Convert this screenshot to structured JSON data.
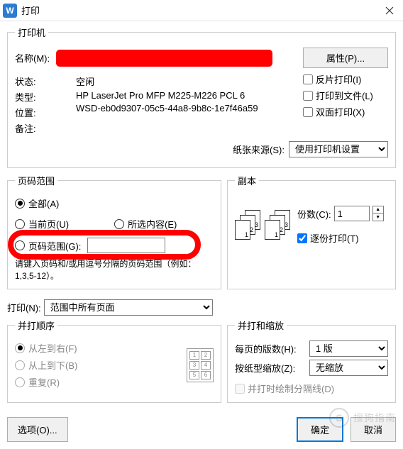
{
  "title": "打印",
  "printer": {
    "legend": "打印机",
    "name_label": "名称(M):",
    "properties_btn": "属性(P)...",
    "status_label": "状态:",
    "status_value": "空闲",
    "type_label": "类型:",
    "type_value": "HP LaserJet Pro MFP M225-M226 PCL 6",
    "location_label": "位置:",
    "location_value": "WSD-eb0d9307-05c5-44a8-9b8c-1e7f46a59",
    "notes_label": "备注:",
    "mirror": "反片打印(I)",
    "to_file": "打印到文件(L)",
    "duplex": "双面打印(X)",
    "source_label": "纸张来源(S):",
    "source_value": "使用打印机设置"
  },
  "range": {
    "legend": "页码范围",
    "all": "全部(A)",
    "current": "当前页(U)",
    "selection": "所选内容(E)",
    "pages": "页码范围(G):",
    "hint": "请键入页码和/或用逗号分隔的页码范围（例如：1,3,5-12）。"
  },
  "copies": {
    "legend": "副本",
    "count_label": "份数(C):",
    "count_value": "1",
    "collate": "逐份打印(T)"
  },
  "print_label": "打印(N):",
  "print_value": "范围中所有页面",
  "order": {
    "legend": "并打顺序",
    "lr": "从左到右(F)",
    "tb": "从上到下(B)",
    "repeat": "重复(R)"
  },
  "scale": {
    "legend": "并打和缩放",
    "per_page_label": "每页的版数(H):",
    "per_page_value": "1 版",
    "scale_label": "按纸型缩放(Z):",
    "scale_value": "无缩放",
    "draw_lines": "并打时绘制分隔线(D)"
  },
  "options_btn": "选项(O)...",
  "ok_btn": "确定",
  "cancel_btn": "取消",
  "watermark": "搜狗指南"
}
